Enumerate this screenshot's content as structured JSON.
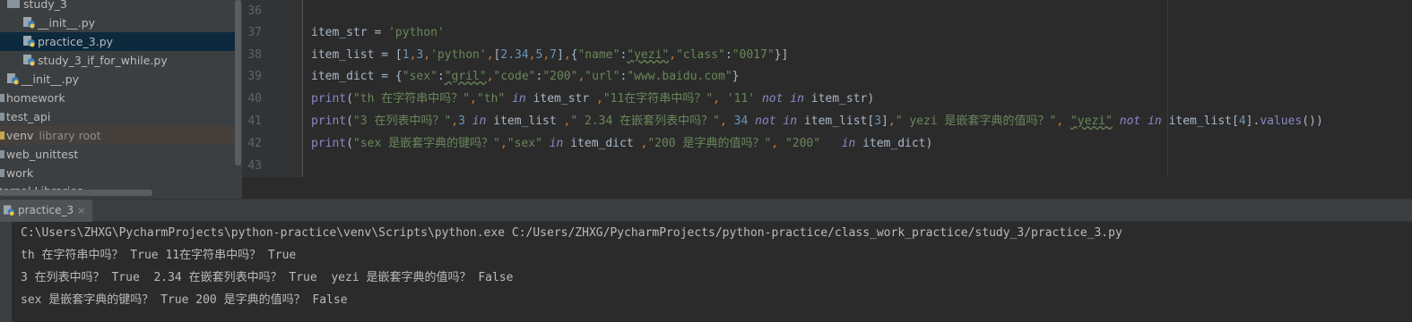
{
  "project_tree": {
    "items": [
      {
        "label": "study_3",
        "type": "folder"
      },
      {
        "label": "__init__.py",
        "type": "py"
      },
      {
        "label": "practice_3.py",
        "type": "py",
        "selected": true
      },
      {
        "label": "study_3_if_for_while.py",
        "type": "py"
      },
      {
        "label": "__init__.py",
        "type": "py"
      },
      {
        "label": "homework",
        "type": "folder"
      },
      {
        "label": "test_api",
        "type": "folder"
      },
      {
        "label": "venv",
        "type": "folder",
        "suffix": "library root"
      },
      {
        "label": "web_unittest",
        "type": "folder"
      },
      {
        "label": "work",
        "type": "folder"
      },
      {
        "label": "ternal Libraries",
        "type": "lib"
      }
    ]
  },
  "editor": {
    "line_numbers": [
      "36",
      "37",
      "38",
      "39",
      "40",
      "41",
      "42",
      "43"
    ],
    "lines": [
      [],
      [
        {
          "t": "item_str ",
          "c": "ident"
        },
        {
          "t": "= ",
          "c": "ident"
        },
        {
          "t": "'python'",
          "c": "str"
        }
      ],
      [
        {
          "t": "item_list ",
          "c": "ident"
        },
        {
          "t": "= [",
          "c": "ident"
        },
        {
          "t": "1",
          "c": "num"
        },
        {
          "t": ",",
          "c": "kw"
        },
        {
          "t": "3",
          "c": "num"
        },
        {
          "t": ",",
          "c": "kw"
        },
        {
          "t": "'python'",
          "c": "str"
        },
        {
          "t": ",",
          "c": "kw"
        },
        {
          "t": "[",
          "c": "ident"
        },
        {
          "t": "2.34",
          "c": "num"
        },
        {
          "t": ",",
          "c": "kw"
        },
        {
          "t": "5",
          "c": "num"
        },
        {
          "t": ",",
          "c": "kw"
        },
        {
          "t": "7",
          "c": "num"
        },
        {
          "t": "]",
          "c": "ident"
        },
        {
          "t": ",",
          "c": "kw"
        },
        {
          "t": "{",
          "c": "ident"
        },
        {
          "t": "\"name\"",
          "c": "str"
        },
        {
          "t": ":",
          "c": "ident"
        },
        {
          "t": "\"yezi\"",
          "c": "str err"
        },
        {
          "t": ",",
          "c": "kw"
        },
        {
          "t": "\"class\"",
          "c": "str"
        },
        {
          "t": ":",
          "c": "ident"
        },
        {
          "t": "\"0017\"",
          "c": "str"
        },
        {
          "t": "}]",
          "c": "ident"
        }
      ],
      [
        {
          "t": "item_dict ",
          "c": "ident"
        },
        {
          "t": "= {",
          "c": "ident"
        },
        {
          "t": "\"sex\"",
          "c": "str"
        },
        {
          "t": ":",
          "c": "ident"
        },
        {
          "t": "\"gril\"",
          "c": "str err"
        },
        {
          "t": ",",
          "c": "kw"
        },
        {
          "t": "\"code\"",
          "c": "str"
        },
        {
          "t": ":",
          "c": "ident"
        },
        {
          "t": "\"200\"",
          "c": "str"
        },
        {
          "t": ",",
          "c": "kw"
        },
        {
          "t": "\"url\"",
          "c": "str"
        },
        {
          "t": ":",
          "c": "ident"
        },
        {
          "t": "\"www.baidu.com\"",
          "c": "str"
        },
        {
          "t": "}",
          "c": "ident"
        }
      ],
      [
        {
          "t": "print",
          "c": "bi"
        },
        {
          "t": "(",
          "c": "ident"
        },
        {
          "t": "\"th 在字符串中吗？\"",
          "c": "str"
        },
        {
          "t": ",",
          "c": "kw"
        },
        {
          "t": "\"th\"",
          "c": "str"
        },
        {
          "t": " in ",
          "c": "kwi"
        },
        {
          "t": "item_str ",
          "c": "ident"
        },
        {
          "t": ",",
          "c": "kw"
        },
        {
          "t": "\"11在字符串中吗？\"",
          "c": "str"
        },
        {
          "t": ", ",
          "c": "kw"
        },
        {
          "t": "'11'",
          "c": "str"
        },
        {
          "t": " not in ",
          "c": "kwi"
        },
        {
          "t": "item_str)",
          "c": "ident"
        }
      ],
      [
        {
          "t": "print",
          "c": "bi"
        },
        {
          "t": "(",
          "c": "ident"
        },
        {
          "t": "\"3 在列表中吗？\"",
          "c": "str"
        },
        {
          "t": ",",
          "c": "kw"
        },
        {
          "t": "3",
          "c": "num"
        },
        {
          "t": " in ",
          "c": "kwi"
        },
        {
          "t": "item_list ",
          "c": "ident"
        },
        {
          "t": ",",
          "c": "kw"
        },
        {
          "t": "\" 2.34 在嵌套列表中吗？\"",
          "c": "str"
        },
        {
          "t": ", ",
          "c": "kw"
        },
        {
          "t": "34",
          "c": "num"
        },
        {
          "t": " not in ",
          "c": "kwi"
        },
        {
          "t": "item_list[",
          "c": "ident"
        },
        {
          "t": "3",
          "c": "num"
        },
        {
          "t": "]",
          "c": "ident"
        },
        {
          "t": ",",
          "c": "kw"
        },
        {
          "t": "\" yezi 是嵌套字典的值吗？\"",
          "c": "str"
        },
        {
          "t": ", ",
          "c": "kw"
        },
        {
          "t": "\"yezi\"",
          "c": "str err"
        },
        {
          "t": " not in ",
          "c": "kwi"
        },
        {
          "t": "item_list[",
          "c": "ident"
        },
        {
          "t": "4",
          "c": "num"
        },
        {
          "t": "].",
          "c": "ident"
        },
        {
          "t": "values",
          "c": "bi"
        },
        {
          "t": "())",
          "c": "ident"
        }
      ],
      [
        {
          "t": "print",
          "c": "bi"
        },
        {
          "t": "(",
          "c": "ident"
        },
        {
          "t": "\"sex 是嵌套字典的键吗？\"",
          "c": "str"
        },
        {
          "t": ",",
          "c": "kw"
        },
        {
          "t": "\"sex\"",
          "c": "str"
        },
        {
          "t": " in ",
          "c": "kwi"
        },
        {
          "t": "item_dict ",
          "c": "ident"
        },
        {
          "t": ",",
          "c": "kw"
        },
        {
          "t": "\"200 是字典的值吗？\"",
          "c": "str"
        },
        {
          "t": ", ",
          "c": "kw"
        },
        {
          "t": "\"200\"",
          "c": "str"
        },
        {
          "t": "   in ",
          "c": "kwi"
        },
        {
          "t": "item_dict)",
          "c": "ident"
        }
      ],
      []
    ]
  },
  "run_panel": {
    "tab_label": "practice_3",
    "close_glyph": "×",
    "output": [
      "C:\\Users\\ZHXG\\PycharmProjects\\python-practice\\venv\\Scripts\\python.exe C:/Users/ZHXG/PycharmProjects/python-practice/class_work_practice/study_3/practice_3.py",
      "th 在字符串中吗？ True 11在字符串中吗？ True",
      "3 在列表中吗？ True  2.34 在嵌套列表中吗？ True  yezi 是嵌套字典的值吗？ False",
      "sex 是嵌套字典的键吗？ True 200 是字典的值吗？ False"
    ]
  },
  "colors": {
    "keyword": "#cc7832",
    "string": "#6a8759",
    "number": "#6897bb",
    "builtin": "#8888c6",
    "text": "#a9b7c6",
    "selection": "#0d293e"
  }
}
